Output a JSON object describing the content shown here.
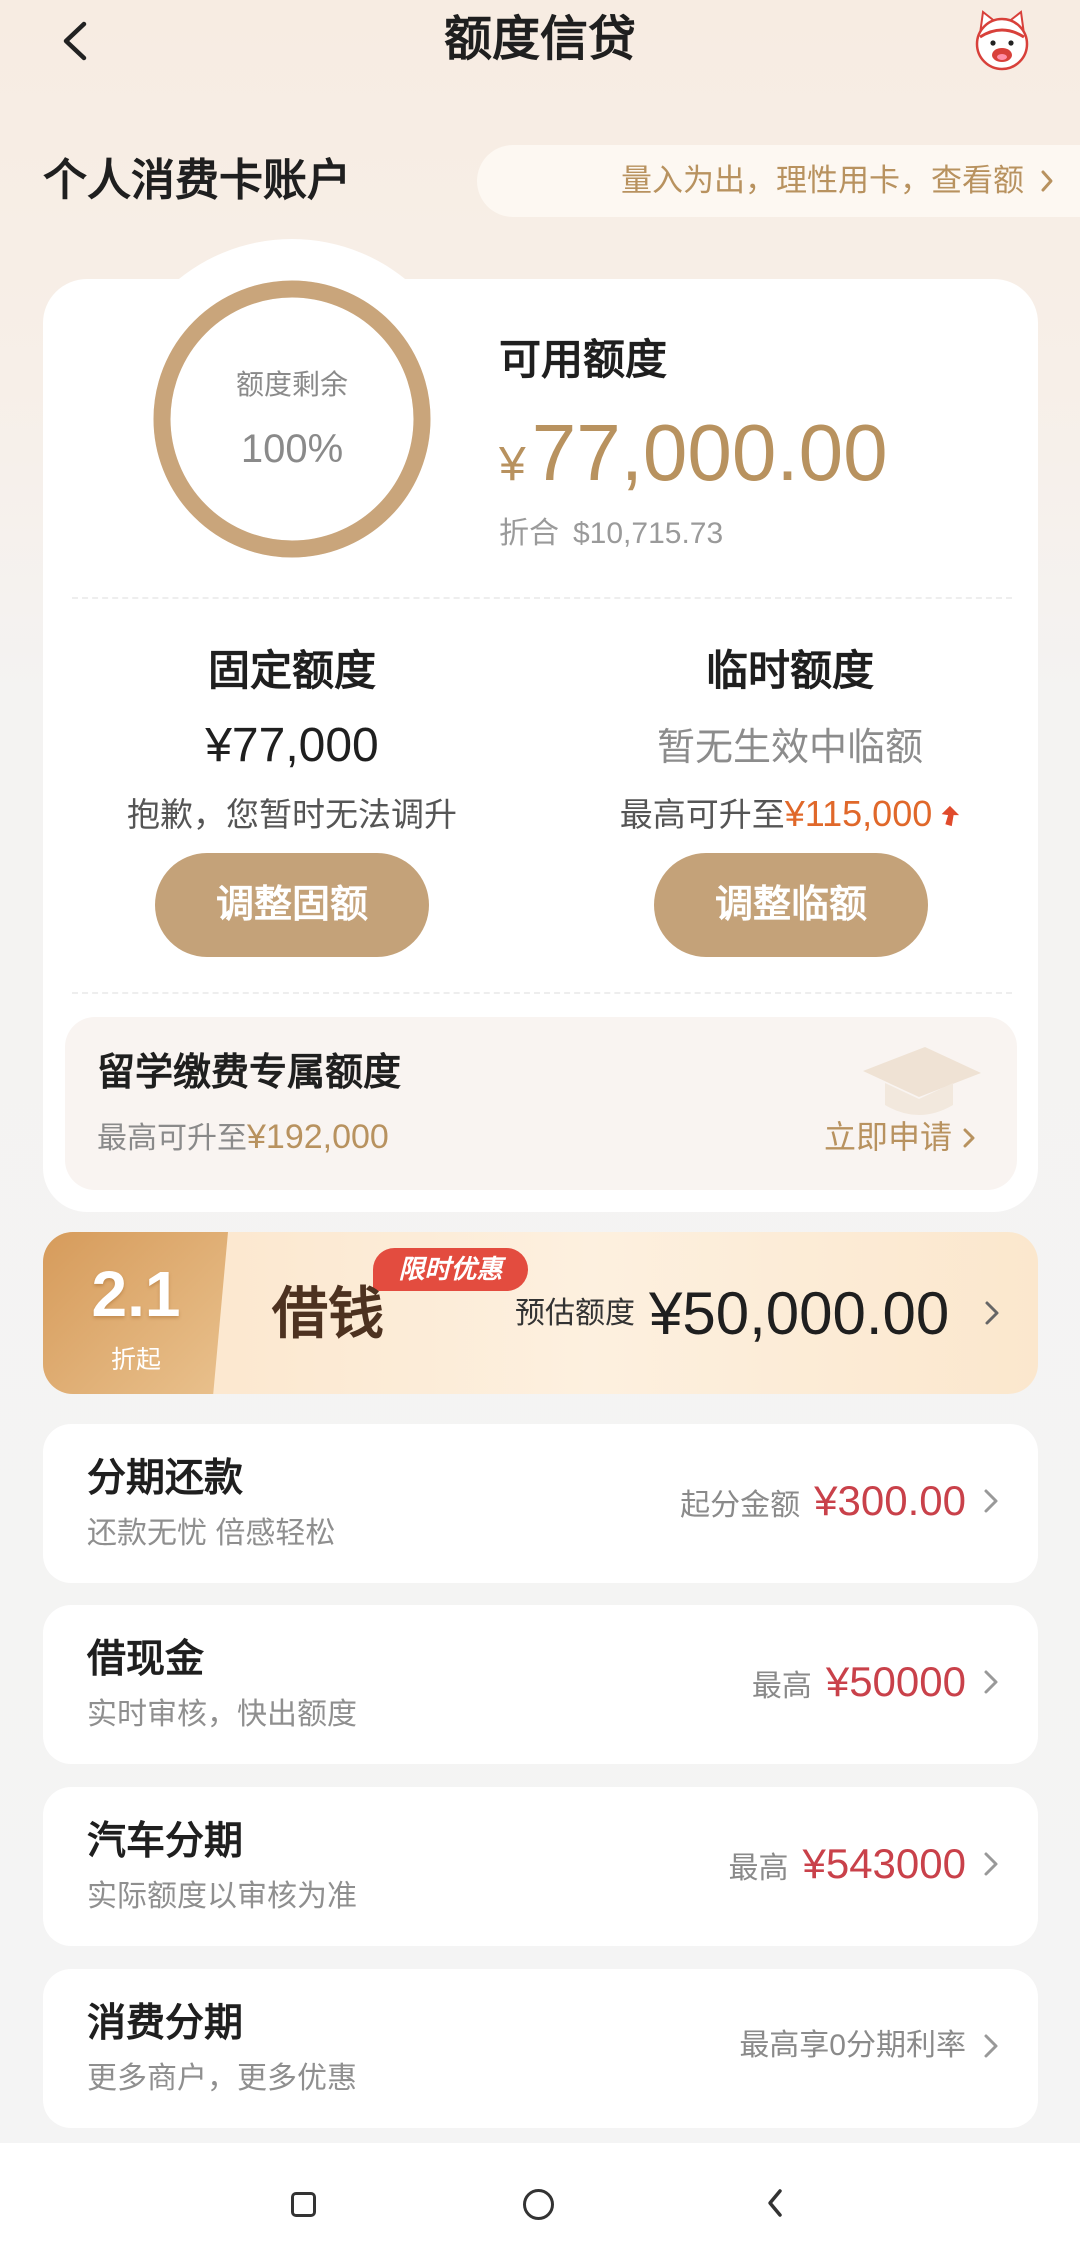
{
  "header": {
    "title": "额度信贷"
  },
  "icons": {
    "back": "back-arrow-icon",
    "mascot": "mascot-avatar-icon",
    "chevron": "chevron-right-icon",
    "study": "graduation-cap-icon",
    "trend": "arrow-up-icon",
    "nav_recent": "square-icon",
    "nav_home": "circle-icon",
    "nav_back": "back-triangle-icon"
  },
  "account": {
    "title": "个人消费卡账户",
    "notice": "量入为出，理性用卡，查看额"
  },
  "summary": {
    "ring_label": "额度剩余",
    "ring_percent": "100%",
    "remaining_fraction": 1.0,
    "available_label": "可用额度",
    "currency": "¥",
    "available_amount": "77,000.00",
    "converted_label": "折合",
    "converted_amount": "$10,715.73"
  },
  "fixed": {
    "title": "固定额度",
    "amount": "¥77,000",
    "note": "抱歉，您暂时无法调升",
    "button": "调整固额"
  },
  "temp": {
    "title": "临时额度",
    "status": "暂无生效中临额",
    "note_prefix": "最高可升至",
    "note_amount": "¥115,000",
    "button": "调整临额"
  },
  "study": {
    "title": "留学缴费专属额度",
    "note_prefix": "最高可升至",
    "note_amount": "¥192,000",
    "action": "立即申请"
  },
  "loan": {
    "rate": "2.1",
    "rate_unit": "折起",
    "badge": "限时优惠",
    "title": "借钱",
    "estimate_label": "预估额度",
    "estimate_amount": "¥50,000.00"
  },
  "services": [
    {
      "title": "分期还款",
      "subtitle": "还款无忧 倍感轻松",
      "label": "起分金额",
      "amount": "¥300.00"
    },
    {
      "title": "借现金",
      "subtitle": "实时审核，快出额度",
      "label": "最高",
      "amount": "¥50000"
    },
    {
      "title": "汽车分期",
      "subtitle": "实际额度以审核为准",
      "label": "最高",
      "amount": "¥543000"
    },
    {
      "title": "消费分期",
      "subtitle": "更多商户，更多优惠",
      "label": "最高享0分期利率"
    }
  ],
  "colors": {
    "accent": "#c4a279",
    "accent_text": "#b8925f",
    "amount_red": "#c9414a",
    "amount_orange": "#e0682a",
    "badge_red": "#e34c3f"
  }
}
